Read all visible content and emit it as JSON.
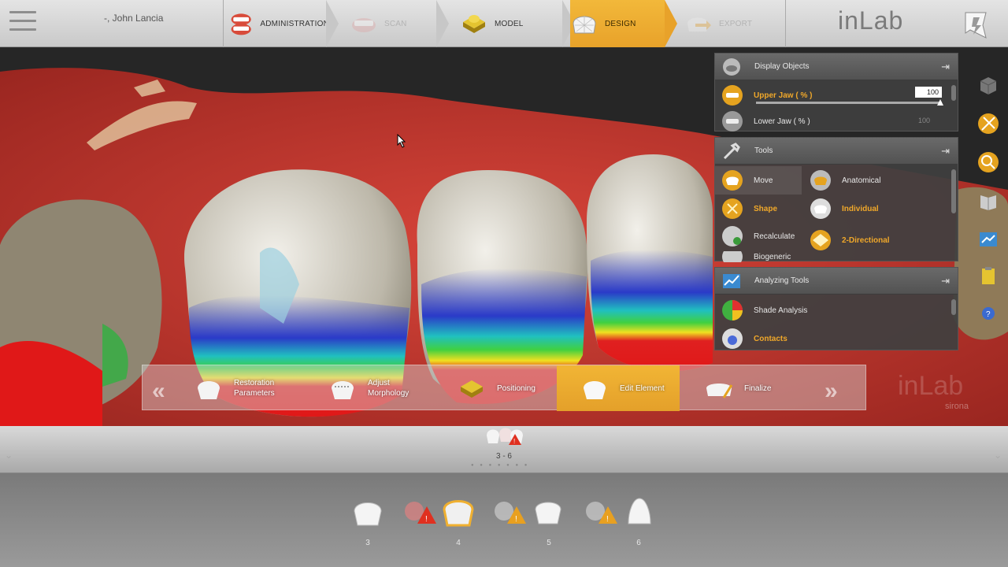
{
  "topbar": {
    "patient": "-, John Lancia",
    "steps": [
      {
        "label": "ADMINISTRATION",
        "state": "normal"
      },
      {
        "label": "SCAN",
        "state": "disabled"
      },
      {
        "label": "MODEL",
        "state": "normal"
      },
      {
        "label": "DESIGN",
        "state": "active"
      },
      {
        "label": "EXPORT",
        "state": "disabled"
      }
    ],
    "logo": "inLab"
  },
  "display_objects": {
    "title": "Display Objects",
    "items": [
      {
        "label": "Upper Jaw  ( % )",
        "value": "100",
        "highlight": true
      },
      {
        "label": "Lower Jaw  ( % )",
        "value": "100",
        "highlight": false
      }
    ]
  },
  "tools": {
    "title": "Tools",
    "items": [
      {
        "label": "Move",
        "highlight": false
      },
      {
        "label": "Anatomical",
        "highlight": false
      },
      {
        "label": "Shape",
        "highlight": true
      },
      {
        "label": "Individual",
        "highlight": true
      },
      {
        "label": "Recalculate",
        "highlight": false
      },
      {
        "label": "2-Directional",
        "highlight": true
      },
      {
        "label": "Biogeneric",
        "highlight": false
      }
    ]
  },
  "analyzing_tools": {
    "title": "Analyzing Tools",
    "items": [
      {
        "label": "Shade Analysis",
        "highlight": false
      },
      {
        "label": "Contacts",
        "highlight": true
      }
    ]
  },
  "workflow": {
    "steps": [
      {
        "label_line1": "Restoration",
        "label_line2": "Parameters",
        "active": false
      },
      {
        "label_line1": "Adjust",
        "label_line2": "Morphology",
        "active": false
      },
      {
        "label_line1": "Positioning",
        "label_line2": "",
        "active": false
      },
      {
        "label_line1": "Edit Element",
        "label_line2": "",
        "active": true
      },
      {
        "label_line1": "Finalize",
        "label_line2": "",
        "active": false
      }
    ]
  },
  "restoration": {
    "label": "3 - 6"
  },
  "teeth": [
    "3",
    "4",
    "5",
    "6"
  ],
  "watermark": {
    "brand": "inLab",
    "maker": "sirona"
  },
  "colors": {
    "accent": "#f0a82a",
    "gingiva": "#c8302a",
    "tooth": "#d6d2c4"
  }
}
